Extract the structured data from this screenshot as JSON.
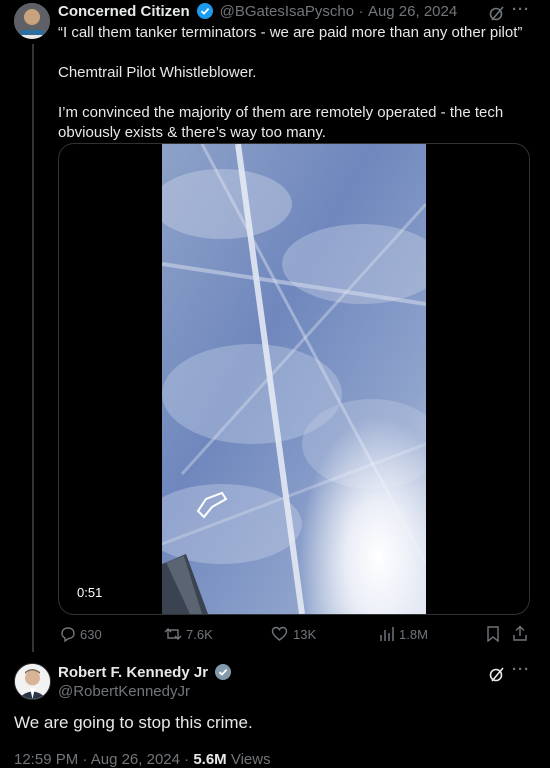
{
  "tweet": {
    "author_name": "Concerned Citizen",
    "handle": "@BGatesIsaPyscho",
    "separator": "·",
    "date": "Aug 26, 2024",
    "lines": [
      "“I call them tanker terminators - we are paid more than any other pilot”",
      "Chemtrail Pilot Whistleblower.",
      "I’m convinced the majority of them are remotely operated - the tech",
      "obviously exists & there’s way too many."
    ],
    "video_duration": "0:51",
    "actions": {
      "replies": "630",
      "reposts": "7.6K",
      "likes": "13K",
      "views": "1.8M"
    },
    "more_glyph": "···",
    "colors": {
      "verified": "#1d9bf0",
      "text": "#e7e9ea",
      "muted": "#71767b"
    }
  },
  "reply": {
    "author_name": "Robert F. Kennedy Jr",
    "handle": "@RobertKennedyJr",
    "text": "We are going to stop this crime.",
    "time": "12:59 PM",
    "separator": "·",
    "date": "Aug 26, 2024",
    "separator2": "·",
    "views_count": "5.6M",
    "views_label": "Views",
    "more_glyph": "···"
  }
}
